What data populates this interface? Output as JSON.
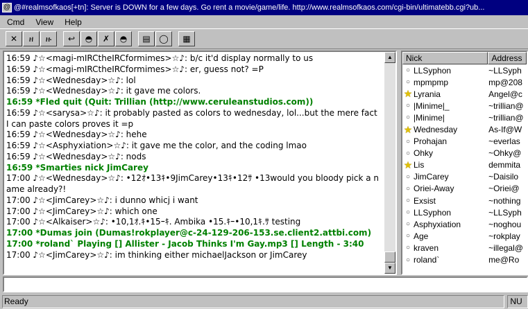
{
  "window": {
    "title": "@#realmsofkaos[+tn]: Server is DOWN for a few days. Go rent a movie/game/life. http://www.realmsofkaos.com/cgi-bin/ultimatebb.cgi?ub..."
  },
  "menu": [
    "Cmd",
    "View",
    "Help"
  ],
  "toolbar": {
    "buttons": [
      {
        "glyph": "✕"
      },
      {
        "glyph": "ዘ"
      },
      {
        "glyph": "ዙ"
      },
      {
        "glyph": "↩"
      },
      {
        "glyph": "◓"
      },
      {
        "glyph": "✗"
      },
      {
        "glyph": "◓"
      },
      {
        "glyph": "▤"
      },
      {
        "glyph": "◯"
      },
      {
        "glyph": "▦"
      }
    ]
  },
  "chat": {
    "lines": [
      {
        "text": "16:59 ♪☆<magi-mIRCtheIRCformimes>☆♪: b/c it'd display normally to us",
        "event": false
      },
      {
        "text": "16:59 ♪☆<magi-mIRCtheIRCformimes>☆♪: er, guess not? =P",
        "event": false
      },
      {
        "text": "16:59 ♪☆<Wednesday>☆♪: lol",
        "event": false
      },
      {
        "text": "16:59 ♪☆<Wednesday>☆♪: it gave me colors.",
        "event": false
      },
      {
        "text": "16:59 *Fled quit (Quit: Trillian (http://www.ceruleanstudios.com))",
        "event": true
      },
      {
        "text": "16:59 ♪☆<sarysa>☆♪: it probably pasted as colors to wednesday, lol...but the mere fact I can paste colors proves it =p",
        "event": false
      },
      {
        "text": "16:59 ♪☆<Wednesday>☆♪: hehe",
        "event": false
      },
      {
        "text": "16:59 ♪☆<Asphyxiation>☆♪: it gave me the color, and the coding lmao",
        "event": false
      },
      {
        "text": "16:59 ♪☆<Wednesday>☆♪: nods",
        "event": false
      },
      {
        "text": "16:59 *Smarties nick JimCarey",
        "event": true
      },
      {
        "text": "17:00 ♪☆<Wednesday>☆♪: •12ｵ•13ｷ•9JimCarey•13ｷ•12ｻ •13would you bloody pick a name already?!",
        "event": false
      },
      {
        "text": "17:00 ♪☆<JimCarey>☆♪: i dunno whicj i want",
        "event": false
      },
      {
        "text": "17:00 ♪☆<JimCarey>☆♪: which one",
        "event": false
      },
      {
        "text": "17:00 ♪☆<Alkaiser>☆♪: •10,1ｵ.ｷ•15ｰｷ. Ambika •15.ｷｰ•10,1ｷ.ｻ testing",
        "event": false
      },
      {
        "text": "17:00 *Dumas join (Dumas!rokplayer@c-24-129-206-153.se.client2.attbi.com)",
        "event": true
      },
      {
        "text": "17:00 *roland` Playing [] Allister - Jacob Thinks I'm Gay.mp3 [] Length - 3:40",
        "event": true
      },
      {
        "text": "17:00 ♪☆<JimCarey>☆♪: im thinking either michaelJackson or JimCarey",
        "event": false
      }
    ]
  },
  "nicklist": {
    "headers": {
      "nick": "Nick",
      "address": "Address"
    },
    "rows": [
      {
        "nick": "LLSyphon",
        "address": "~LLSyph",
        "star": false
      },
      {
        "nick": "mpmpmp",
        "address": "mp@208",
        "star": false
      },
      {
        "nick": "Lyrania",
        "address": "Angel@c",
        "star": true
      },
      {
        "nick": "|Minime|_",
        "address": "~trillian@",
        "star": false
      },
      {
        "nick": "|Minime|",
        "address": "~trillian@",
        "star": false
      },
      {
        "nick": "Wednesday",
        "address": "As-If@W",
        "star": true
      },
      {
        "nick": "Prohajan",
        "address": "~everlas",
        "star": false
      },
      {
        "nick": "Ohky",
        "address": "~Ohky@",
        "star": false
      },
      {
        "nick": "Lis",
        "address": "demmita",
        "star": true
      },
      {
        "nick": "JimCarey",
        "address": "~Daisilo",
        "star": false
      },
      {
        "nick": "Oriei-Away",
        "address": "~Oriei@",
        "star": false
      },
      {
        "nick": "Exsist",
        "address": "~nothing",
        "star": false
      },
      {
        "nick": "LLSyphon",
        "address": "~LLSyph",
        "star": false
      },
      {
        "nick": "Asphyxiation",
        "address": "~noghou",
        "star": false
      },
      {
        "nick": "Age",
        "address": "~rokplay",
        "star": false
      },
      {
        "nick": "kraven",
        "address": "~illegal@",
        "star": false
      },
      {
        "nick": "roland`",
        "address": "me@Ro",
        "star": false
      }
    ]
  },
  "statusbar": {
    "text": "Ready",
    "indicator": "NU"
  }
}
